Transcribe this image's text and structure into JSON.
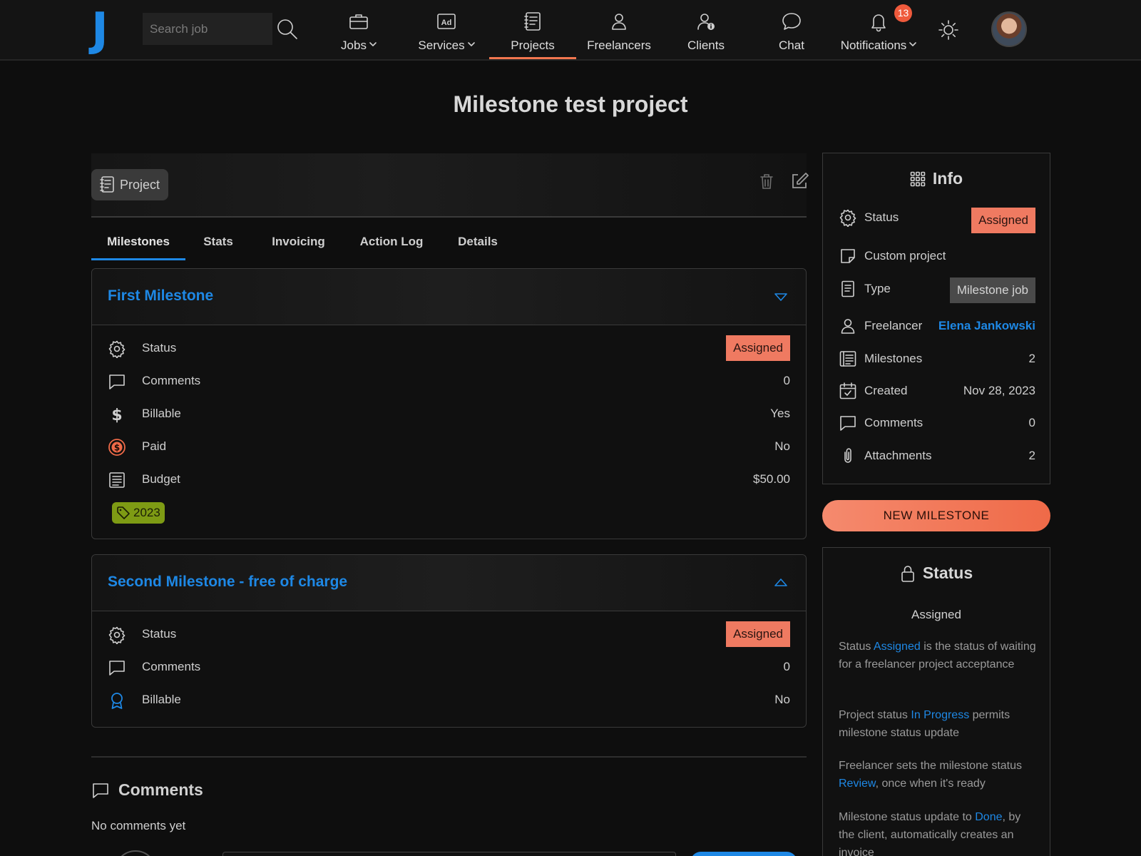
{
  "nav": {
    "logo": "J",
    "search_placeholder": "Search job",
    "items": [
      {
        "label": "Jobs",
        "icon": "briefcase-icon",
        "dropdown": true
      },
      {
        "label": "Services",
        "icon": "ad-icon",
        "dropdown": true
      },
      {
        "label": "Projects",
        "icon": "notebook-icon",
        "active": true
      },
      {
        "label": "Freelancers",
        "icon": "person-icon"
      },
      {
        "label": "Clients",
        "icon": "person-info-icon"
      },
      {
        "label": "Chat",
        "icon": "chat-bubble-icon"
      },
      {
        "label": "Notifications",
        "icon": "bell-icon",
        "dropdown": true
      }
    ],
    "notification_count": "13",
    "active_color": "#f2764f"
  },
  "page": {
    "title": "Milestone test project",
    "chip_label": "Project"
  },
  "tabs": [
    "Milestones",
    "Stats",
    "Invoicing",
    "Action Log",
    "Details"
  ],
  "milestones": [
    {
      "title": "First Milestone",
      "rows": [
        {
          "label": "Status",
          "value": "Assigned"
        },
        {
          "label": "Comments",
          "value": "0"
        },
        {
          "label": "Billable",
          "value": "Yes"
        },
        {
          "label": "Paid",
          "value": "No"
        },
        {
          "label": "Budget",
          "value": "$50.00"
        }
      ],
      "tag": "2023"
    },
    {
      "title": "Second Milestone - free of charge",
      "rows": [
        {
          "label": "Status",
          "value": "Assigned"
        },
        {
          "label": "Comments",
          "value": "0"
        },
        {
          "label": "Billable",
          "value": "No"
        }
      ]
    }
  ],
  "comments": {
    "heading": "Comments",
    "empty_text": "No comments yet"
  },
  "info": {
    "title": "Info",
    "status_label": "Status",
    "status_value": "Assigned",
    "custom_label": "Custom project",
    "type_label": "Type",
    "type_value": "Milestone job",
    "freelancer_label": "Freelancer",
    "freelancer_value": "Elena Jankowski",
    "milestones_label": "Milestones",
    "milestones_value": "2",
    "created_label": "Created",
    "created_value": "Nov 28, 2023",
    "comments_label": "Comments",
    "comments_value": "0",
    "attachments_label": "Attachments",
    "attachments_value": "2"
  },
  "new_milestone_label": "NEW MILESTONE",
  "status_card": {
    "title": "Status",
    "current": "Assigned",
    "p1_a": "Status ",
    "p1_link": "Assigned",
    "p1_b": " is the status of waiting for a freelancer project acceptance",
    "p2_a": "Project status ",
    "p2_link": "In Progress",
    "p2_b": " permits milestone status update",
    "p3_a": "Freelancer sets the milestone status ",
    "p3_link": "Review",
    "p3_b": ", once when it's ready",
    "p4_a": "Milestone status update to ",
    "p4_link": "Done",
    "p4_b": ", by the client, automatically creates an invoice"
  },
  "colors": {
    "accent_blue": "#1e88e5",
    "assigned_badge": "#ef7a61",
    "tag_green": "#7e9b14",
    "background": "#0e0e0e"
  }
}
